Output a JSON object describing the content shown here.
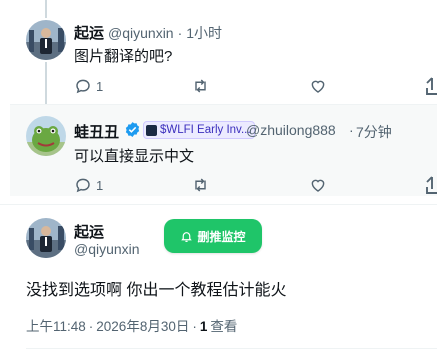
{
  "reply1": {
    "name": "起运",
    "handle": "@qiyunxin",
    "time": "1小时",
    "text": "图片翻译的吧?",
    "reply_count": "1",
    "retweet_count": "",
    "like_count": ""
  },
  "reply2": {
    "name": "蛙丑丑",
    "badge": "$WLFI Early Inv...",
    "handle": "@zhuilong888",
    "time": "7分钟",
    "text": "可以直接显示中文",
    "reply_count": "1",
    "retweet_count": "",
    "like_count": ""
  },
  "main_tweet": {
    "name": "起运",
    "handle": "@qiyunxin",
    "follow_button_label": "删推监控",
    "text": "没找到选项啊 你出一个教程估计能火",
    "time": "上午11:48",
    "date": "2026年8月30日",
    "views_count": "1",
    "views_label": "查看"
  },
  "colors": {
    "accent_green": "#1fc569",
    "verified_blue": "#1d9bf0",
    "muted_text": "#536471",
    "thread_line": "#cfd9de"
  },
  "icons": [
    "reply-icon",
    "retweet-icon",
    "like-icon",
    "bell-icon",
    "verified-icon"
  ]
}
